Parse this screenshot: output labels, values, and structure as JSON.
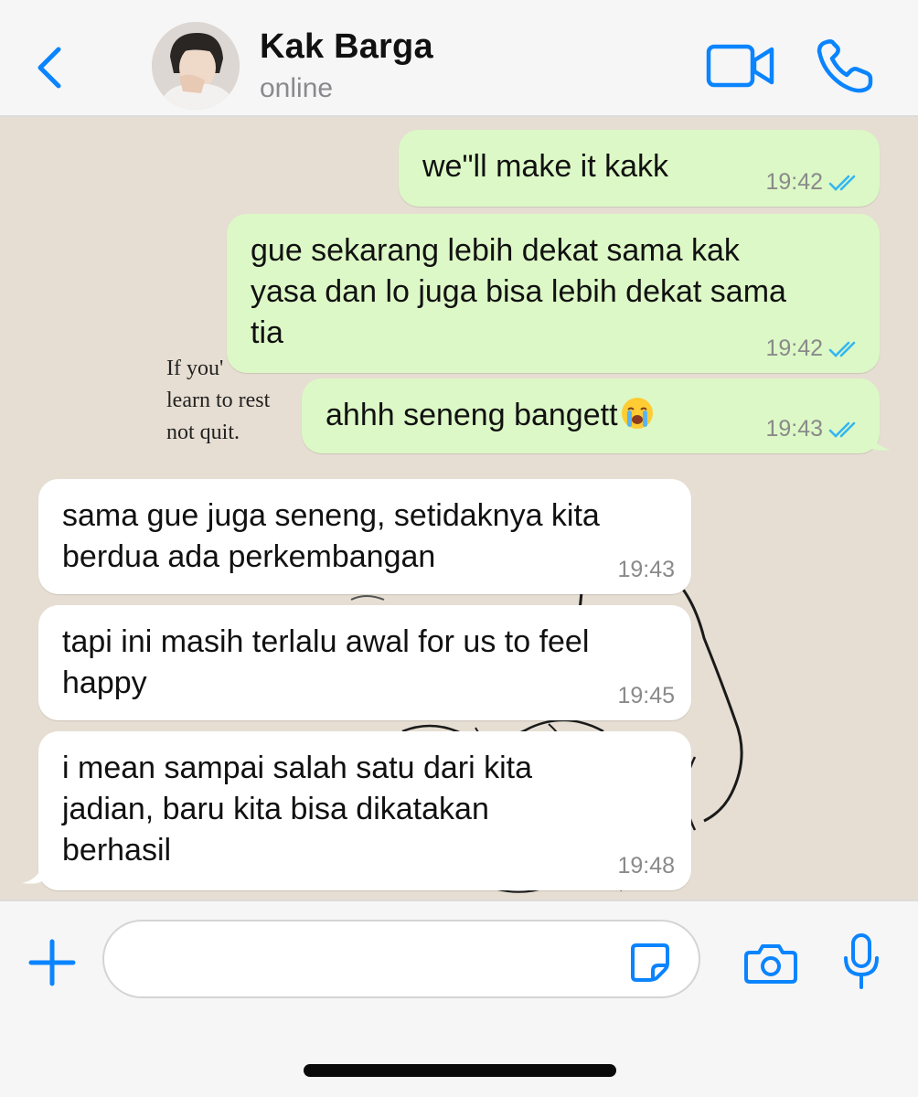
{
  "header": {
    "back_icon": "chevron-left-icon",
    "contact_name": "Kak Barga",
    "status": "online",
    "video_icon": "video-call-icon",
    "call_icon": "phone-icon",
    "accent_color": "#0a84ff"
  },
  "wallpaper": {
    "quote_lines": [
      "If you'",
      "learn to rest",
      "not quit."
    ]
  },
  "messages": [
    {
      "direction": "outgoing",
      "lines": [
        "we\"ll make it kakk"
      ],
      "time": "19:42",
      "read": true
    },
    {
      "direction": "outgoing",
      "lines": [
        "gue sekarang lebih dekat sama kak",
        "yasa dan lo juga bisa lebih dekat sama",
        "tia"
      ],
      "time": "19:42",
      "read": true
    },
    {
      "direction": "outgoing",
      "lines": [
        "ahhh seneng bangett"
      ],
      "emoji": "loudly-crying-face",
      "time": "19:43",
      "read": true
    },
    {
      "direction": "incoming",
      "lines": [
        "sama gue juga seneng, setidaknya kita",
        "berdua ada perkembangan"
      ],
      "time": "19:43"
    },
    {
      "direction": "incoming",
      "lines": [
        "tapi ini masih terlalu awal for us to feel",
        "happy"
      ],
      "time": "19:45"
    },
    {
      "direction": "incoming",
      "lines": [
        "i mean sampai salah satu dari kita",
        "jadian, baru kita bisa dikatakan",
        "berhasil"
      ],
      "time": "19:48"
    }
  ],
  "input_bar": {
    "placeholder": "",
    "value": "",
    "icons": [
      "plus-icon",
      "sticker-icon",
      "camera-icon",
      "microphone-icon"
    ]
  },
  "colors": {
    "outgoing_bubble": "#dcf8c6",
    "incoming_bubble": "#ffffff",
    "read_ticks": "#34b7f1",
    "chat_background": "#e6ded2"
  }
}
